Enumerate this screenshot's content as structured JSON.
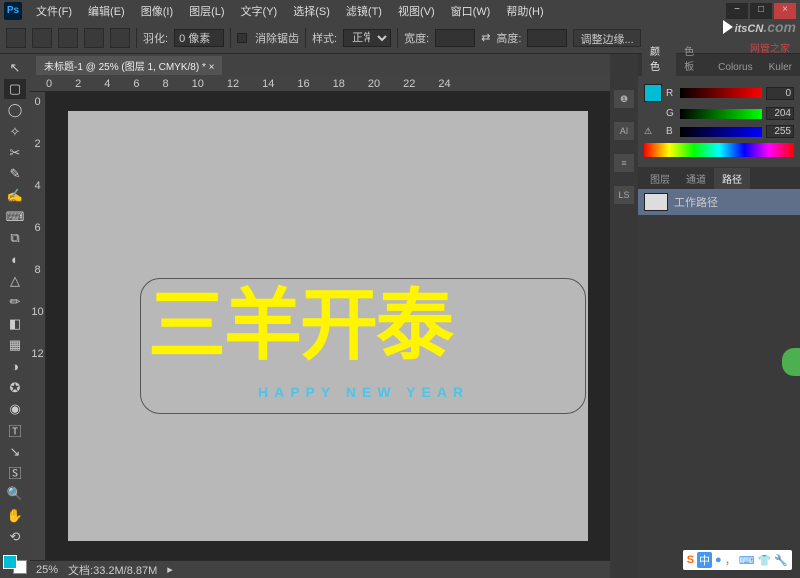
{
  "menu": [
    "文件(F)",
    "编辑(E)",
    "图像(I)",
    "图层(L)",
    "文字(Y)",
    "选择(S)",
    "滤镜(T)",
    "视图(V)",
    "窗口(W)",
    "帮助(H)"
  ],
  "options": {
    "feather_label": "羽化:",
    "feather_value": "0 像素",
    "antialias": "消除锯齿",
    "style_label": "样式:",
    "style_value": "正常",
    "width_label": "宽度:",
    "height_label": "高度:",
    "refine": "调整边缘..."
  },
  "doc_tab": "未标题-1 @ 25% (图层 1, CMYK/8) * ×",
  "ruler_h": [
    "0",
    "2",
    "4",
    "6",
    "8",
    "10",
    "12",
    "14",
    "16",
    "18",
    "20",
    "22",
    "24"
  ],
  "ruler_v": [
    "0",
    "2",
    "4",
    "6",
    "8",
    "10",
    "12"
  ],
  "artboard": {
    "main": "三羊开泰",
    "sub": "HAPPY NEW YEAR"
  },
  "status": {
    "zoom": "25%",
    "docinfo": "文档:33.2M/8.87M"
  },
  "color_tabs": [
    "颜色",
    "色板",
    "Colorus",
    "Kuler"
  ],
  "color": {
    "r_label": "R",
    "r_val": "0",
    "g_label": "G",
    "g_val": "204",
    "b_label": "B",
    "b_val": "255"
  },
  "path_tabs": [
    "图层",
    "通道",
    "路径"
  ],
  "path_item": "工作路径",
  "watermark": {
    "brand": "itsCN",
    "tld": ".com",
    "sub": "网管之家"
  },
  "ime": {
    "zh": "中"
  },
  "collapsed": [
    "❶",
    "AI",
    "≡",
    "LS"
  ]
}
